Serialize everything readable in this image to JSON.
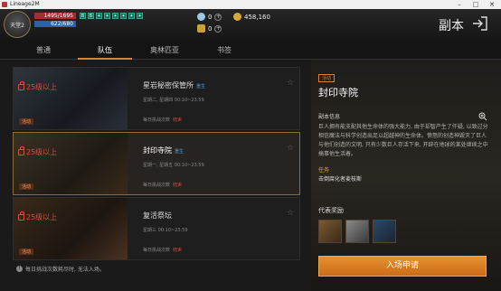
{
  "window": {
    "title": "Lineage2M"
  },
  "player": {
    "portrait_text": "天堂2",
    "hp": "1495/1695",
    "mp": "622/680"
  },
  "buffs": [
    "B",
    "B",
    "✦",
    "✦",
    "✦",
    "✦",
    "✦",
    "✦"
  ],
  "currency": {
    "diamond": "0",
    "gold": "458,160",
    "token": "0",
    "plus": "+"
  },
  "header": {
    "title": "副本"
  },
  "tabs": [
    {
      "label": "普通"
    },
    {
      "label": "队伍"
    },
    {
      "label": "奥林匹亚"
    },
    {
      "label": "书签"
    }
  ],
  "dungeons": [
    {
      "lock": "25级以上",
      "tag": "活动",
      "name": "星岩秘密保管所",
      "badge": "重生",
      "time": "星期二, 星期四  00:10~23:59",
      "limit": "每日挑战次数",
      "status": "结束"
    },
    {
      "lock": "25级以上",
      "tag": "活动",
      "name": "封印寺院",
      "badge": "重生",
      "time": "星期一, 星期五  00:10~23:59",
      "limit": "每日挑战次数",
      "status": "结束"
    },
    {
      "lock": "25级以上",
      "tag": "活动",
      "name": "复活祭坛",
      "badge": "",
      "time": "星期三  00:10~23:59",
      "limit": "每日挑战次数",
      "status": "结束"
    }
  ],
  "footer": {
    "note": "每日挑战次数耗尽时, 无法入场。"
  },
  "detail": {
    "status": "活动",
    "title": "封印寺院",
    "info_heading": "副本信息",
    "description": "巨人拥有能支配其他生命体的强大能力, 由于却智产生了仟疑, 以致过分相信魔法与科学创造出足以超越神的生命体。愤怒的创造神毁灭了巨人与他们创造的文明, 只有少数巨人存活下来, 开辟在地球的某处继续之中搞事他生活着。",
    "task_heading": "任务",
    "task": "击倒腐化者麦枝斯",
    "reward_heading": "代表奖励",
    "enter_label": "入场申请"
  }
}
